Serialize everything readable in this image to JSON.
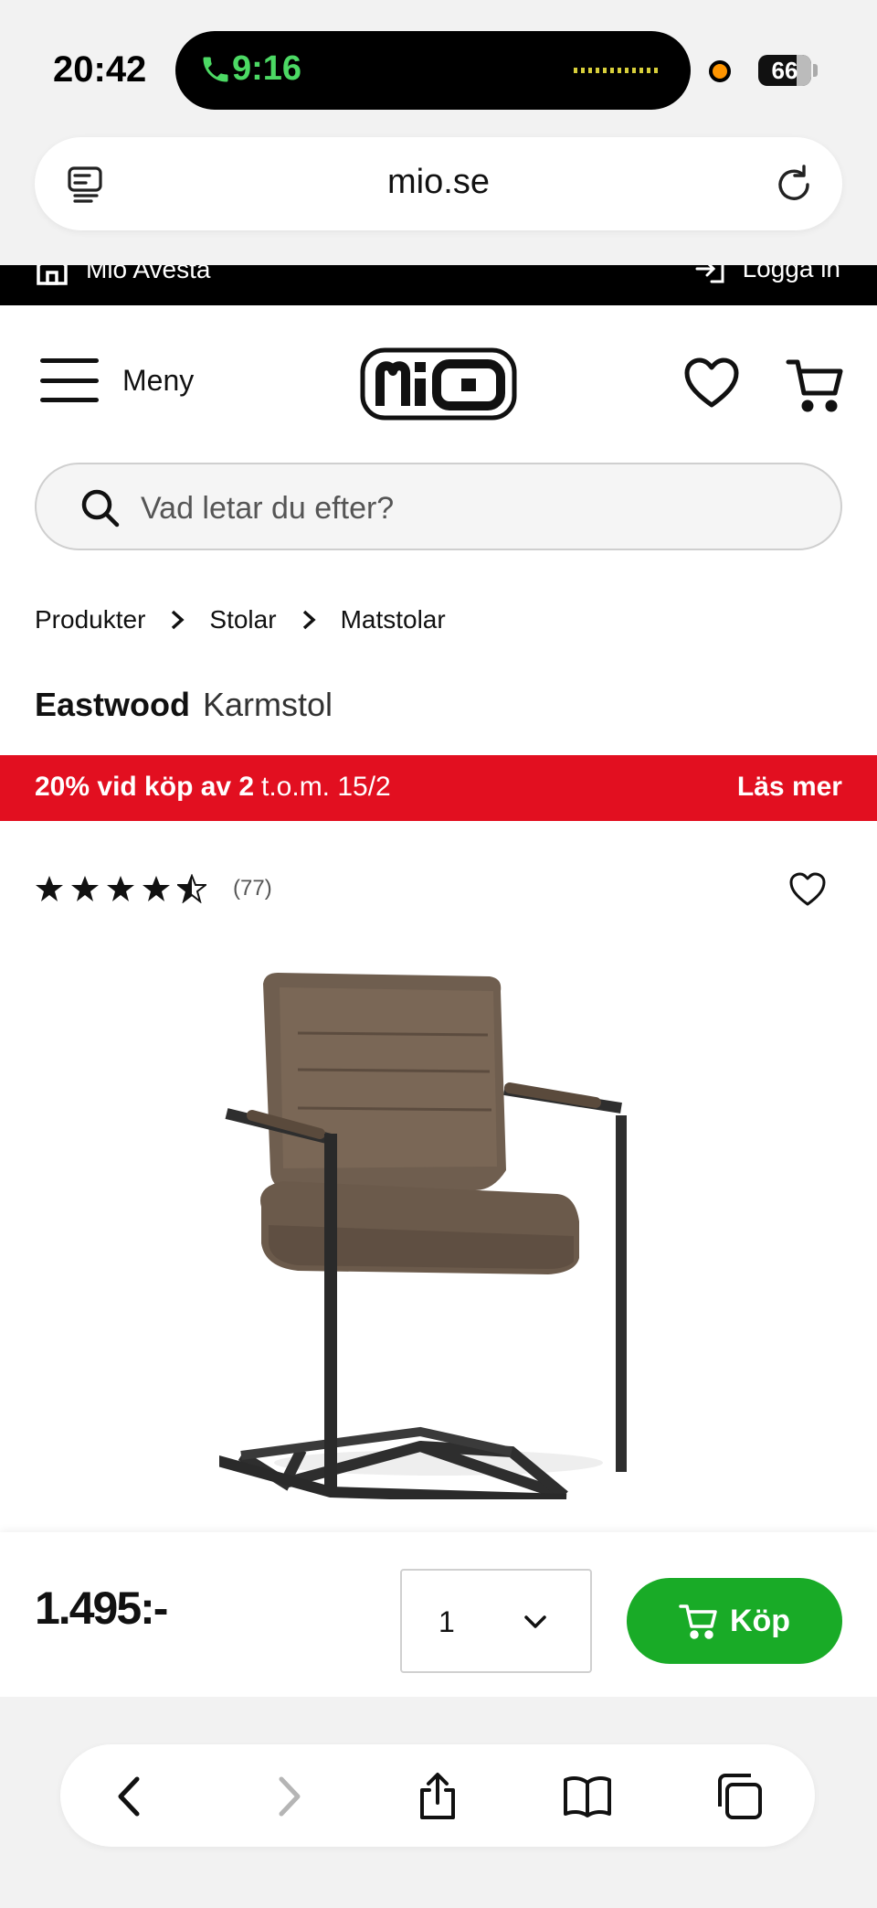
{
  "status_bar": {
    "time": "20:42",
    "call_time": "9:16",
    "battery": "66"
  },
  "browser": {
    "url": "mio.se"
  },
  "top_strip": {
    "store": "Mio Avesta",
    "login": "Logga in"
  },
  "header": {
    "menu_label": "Meny"
  },
  "search": {
    "placeholder": "Vad letar du efter?"
  },
  "breadcrumb": [
    {
      "label": "Produkter"
    },
    {
      "label": "Stolar"
    },
    {
      "label": "Matstolar"
    }
  ],
  "product": {
    "brand": "Eastwood",
    "type": "Karmstol",
    "rating": 4.5,
    "review_count": "(77)",
    "price": "1.495:-",
    "quantity": "1",
    "buy_label": "Köp"
  },
  "promo": {
    "offer": "20% vid köp av 2",
    "period": "t.o.m. 15/2",
    "link": "Läs mer"
  },
  "colors": {
    "accent_red": "#e20f20",
    "buy_green": "#19ab27",
    "call_green": "#4cd964"
  }
}
